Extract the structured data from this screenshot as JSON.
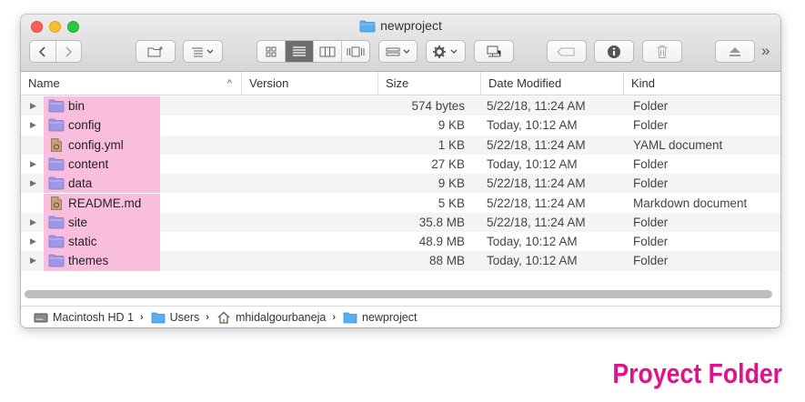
{
  "window": {
    "title": "newproject",
    "more_label": "»"
  },
  "columns": {
    "name": "Name",
    "version": "Version",
    "size": "Size",
    "date_modified": "Date Modified",
    "kind": "Kind",
    "sort_indicator": "^"
  },
  "files": [
    {
      "name": "bin",
      "size": "574 bytes",
      "date": "5/22/18, 11:24 AM",
      "kind": "Folder",
      "icon": "folder-icon"
    },
    {
      "name": "config",
      "size": "9 KB",
      "date": "Today, 10:12 AM",
      "kind": "Folder",
      "icon": "folder-icon"
    },
    {
      "name": "config.yml",
      "size": "1 KB",
      "date": "5/22/18, 11:24 AM",
      "kind": "YAML document",
      "icon": "document-icon"
    },
    {
      "name": "content",
      "size": "27 KB",
      "date": "Today, 10:12 AM",
      "kind": "Folder",
      "icon": "folder-icon"
    },
    {
      "name": "data",
      "size": "9 KB",
      "date": "5/22/18, 11:24 AM",
      "kind": "Folder",
      "icon": "folder-icon"
    },
    {
      "name": "README.md",
      "size": "5 KB",
      "date": "5/22/18, 11:24 AM",
      "kind": "Markdown document",
      "icon": "document-icon"
    },
    {
      "name": "site",
      "size": "35.8 MB",
      "date": "5/22/18, 11:24 AM",
      "kind": "Folder",
      "icon": "folder-icon"
    },
    {
      "name": "static",
      "size": "48.9 MB",
      "date": "Today, 10:12 AM",
      "kind": "Folder",
      "icon": "folder-icon"
    },
    {
      "name": "themes",
      "size": "88 MB",
      "date": "Today, 10:12 AM",
      "kind": "Folder",
      "icon": "folder-icon"
    }
  ],
  "pathbar": {
    "crumbs": [
      "Macintosh HD 1",
      "Users",
      "mhidalgourbaneja",
      "newproject"
    ],
    "separator": "›"
  },
  "caption": "Proyect Folder",
  "colors": {
    "highlight": "#f9bedd",
    "folder": "#9f97e6",
    "caption": "#e0138c"
  }
}
